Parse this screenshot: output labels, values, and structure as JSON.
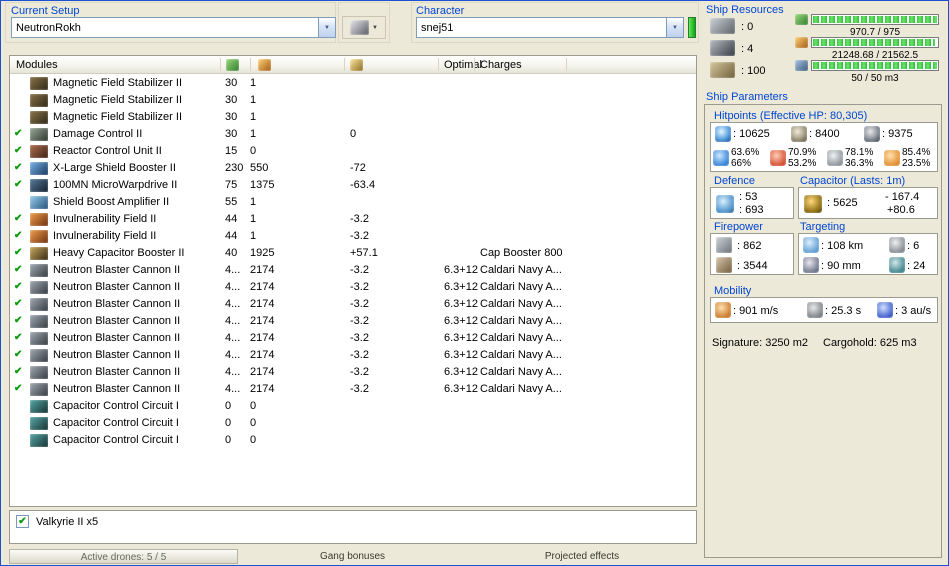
{
  "topbar": {
    "current_setup_label": "Current Setup",
    "current_setup_value": "NeutronRokh",
    "character_label": "Character",
    "character_value": "snej51"
  },
  "resources": {
    "title": "Ship Resources",
    "slots": [
      {
        "icon": "turret-hardpoint-icon",
        "value": ": 0"
      },
      {
        "icon": "launcher-hardpoint-icon",
        "value": ": 4"
      },
      {
        "icon": "calibration-icon",
        "value": ": 100"
      }
    ],
    "bars": [
      {
        "icon": "cpu-icon",
        "value": "970.7 / 975",
        "pct": 99.6
      },
      {
        "icon": "powergrid-icon",
        "value": "21248.68 / 21562.5",
        "pct": 98.5
      },
      {
        "icon": "dronebay-icon",
        "value": "50 / 50 m3",
        "pct": 100
      }
    ]
  },
  "params": {
    "title": "Ship Parameters",
    "hitpoints_title": "Hitpoints (Effective HP: 80,305)",
    "hp": {
      "shield": ": 10625",
      "armor": ": 8400",
      "structure": ": 9375",
      "resists": [
        {
          "icon": "em-resist-icon",
          "top": "63.6%",
          "bottom": "66%"
        },
        {
          "icon": "thermal-resist-icon",
          "top": "70.9%",
          "bottom": "53.2%"
        },
        {
          "icon": "kinetic-resist-icon",
          "top": "78.1%",
          "bottom": "36.3%"
        },
        {
          "icon": "explosive-resist-icon",
          "top": "85.4%",
          "bottom": "23.5%"
        }
      ]
    },
    "defence": {
      "title": "Defence",
      "value1": ": 53",
      "value2": ": 693"
    },
    "capacitor": {
      "title": "Capacitor (Lasts: 1m)",
      "amount": ": 5625",
      "delta_out": "- 167.4",
      "delta_in": "+80.6"
    },
    "firepower": {
      "title": "Firepower",
      "dps": ": 862",
      "volley": ": 3544"
    },
    "targeting": {
      "title": "Targeting",
      "range": ": 108 km",
      "max_targets": ": 6",
      "scan_res": ": 90 mm",
      "sensor_strength": ": 24"
    },
    "mobility": {
      "title": "Mobility",
      "speed": ": 901 m/s",
      "align": ": 25.3 s",
      "warp": ": 3 au/s"
    },
    "signature": "Signature: 3250 m2",
    "cargohold": "Cargohold: 625 m3"
  },
  "modules": {
    "header_label": "Modules",
    "optimal_label": "Optimal",
    "charges_label": "Charges",
    "rows": [
      {
        "active": false,
        "icon": "mag-stab-icon",
        "name": "Magnetic Field Stabilizer II",
        "cpu": "30",
        "pg": "1",
        "cap": "",
        "optimal": "",
        "charge": ""
      },
      {
        "active": false,
        "icon": "mag-stab-icon",
        "name": "Magnetic Field Stabilizer II",
        "cpu": "30",
        "pg": "1",
        "cap": "",
        "optimal": "",
        "charge": ""
      },
      {
        "active": false,
        "icon": "mag-stab-icon",
        "name": "Magnetic Field Stabilizer II",
        "cpu": "30",
        "pg": "1",
        "cap": "",
        "optimal": "",
        "charge": ""
      },
      {
        "active": true,
        "icon": "damage-control-icon",
        "name": "Damage Control II",
        "cpu": "30",
        "pg": "1",
        "cap": "0",
        "optimal": "",
        "charge": ""
      },
      {
        "active": true,
        "icon": "reactor-control-icon",
        "name": "Reactor Control Unit II",
        "cpu": "15",
        "pg": "0",
        "cap": "",
        "optimal": "",
        "charge": ""
      },
      {
        "active": true,
        "icon": "shield-booster-icon",
        "name": "X-Large Shield Booster II",
        "cpu": "230",
        "pg": "550",
        "cap": "-72",
        "optimal": "",
        "charge": ""
      },
      {
        "active": true,
        "icon": "mwd-icon",
        "name": "100MN MicroWarpdrive II",
        "cpu": "75",
        "pg": "1375",
        "cap": "-63.4",
        "optimal": "",
        "charge": ""
      },
      {
        "active": false,
        "icon": "shield-boost-amp-icon",
        "name": "Shield Boost Amplifier II",
        "cpu": "55",
        "pg": "1",
        "cap": "",
        "optimal": "",
        "charge": ""
      },
      {
        "active": true,
        "icon": "invuln-field-icon",
        "name": "Invulnerability Field II",
        "cpu": "44",
        "pg": "1",
        "cap": "-3.2",
        "optimal": "",
        "charge": ""
      },
      {
        "active": true,
        "icon": "invuln-field-icon",
        "name": "Invulnerability Field II",
        "cpu": "44",
        "pg": "1",
        "cap": "-3.2",
        "optimal": "",
        "charge": ""
      },
      {
        "active": true,
        "icon": "cap-booster-icon",
        "name": "Heavy Capacitor Booster II",
        "cpu": "40",
        "pg": "1925",
        "cap": "+57.1",
        "optimal": "",
        "charge": "Cap Booster 800"
      },
      {
        "active": true,
        "icon": "blaster-icon",
        "name": "Neutron Blaster Cannon II",
        "cpu": "4...",
        "pg": "2174",
        "cap": "-3.2",
        "optimal": "6.3+12",
        "charge": "Caldari Navy A..."
      },
      {
        "active": true,
        "icon": "blaster-icon",
        "name": "Neutron Blaster Cannon II",
        "cpu": "4...",
        "pg": "2174",
        "cap": "-3.2",
        "optimal": "6.3+12",
        "charge": "Caldari Navy A..."
      },
      {
        "active": true,
        "icon": "blaster-icon",
        "name": "Neutron Blaster Cannon II",
        "cpu": "4...",
        "pg": "2174",
        "cap": "-3.2",
        "optimal": "6.3+12",
        "charge": "Caldari Navy A..."
      },
      {
        "active": true,
        "icon": "blaster-icon",
        "name": "Neutron Blaster Cannon II",
        "cpu": "4...",
        "pg": "2174",
        "cap": "-3.2",
        "optimal": "6.3+12",
        "charge": "Caldari Navy A..."
      },
      {
        "active": true,
        "icon": "blaster-icon",
        "name": "Neutron Blaster Cannon II",
        "cpu": "4...",
        "pg": "2174",
        "cap": "-3.2",
        "optimal": "6.3+12",
        "charge": "Caldari Navy A..."
      },
      {
        "active": true,
        "icon": "blaster-icon",
        "name": "Neutron Blaster Cannon II",
        "cpu": "4...",
        "pg": "2174",
        "cap": "-3.2",
        "optimal": "6.3+12",
        "charge": "Caldari Navy A..."
      },
      {
        "active": true,
        "icon": "blaster-icon",
        "name": "Neutron Blaster Cannon II",
        "cpu": "4...",
        "pg": "2174",
        "cap": "-3.2",
        "optimal": "6.3+12",
        "charge": "Caldari Navy A..."
      },
      {
        "active": true,
        "icon": "blaster-icon",
        "name": "Neutron Blaster Cannon II",
        "cpu": "4...",
        "pg": "2174",
        "cap": "-3.2",
        "optimal": "6.3+12",
        "charge": "Caldari Navy A..."
      },
      {
        "active": false,
        "icon": "ccc-rig-icon",
        "name": "Capacitor Control Circuit I",
        "cpu": "0",
        "pg": "0",
        "cap": "",
        "optimal": "",
        "charge": ""
      },
      {
        "active": false,
        "icon": "ccc-rig-icon",
        "name": "Capacitor Control Circuit I",
        "cpu": "0",
        "pg": "0",
        "cap": "",
        "optimal": "",
        "charge": ""
      },
      {
        "active": false,
        "icon": "ccc-rig-icon",
        "name": "Capacitor Control Circuit I",
        "cpu": "0",
        "pg": "0",
        "cap": "",
        "optimal": "",
        "charge": ""
      }
    ]
  },
  "drones": {
    "label": "Valkyrie II x5",
    "checked": true
  },
  "bottom_tabs": [
    {
      "label": "Active drones: 5 / 5"
    },
    {
      "label": "Gang bonuses"
    },
    {
      "label": "Projected effects"
    }
  ]
}
